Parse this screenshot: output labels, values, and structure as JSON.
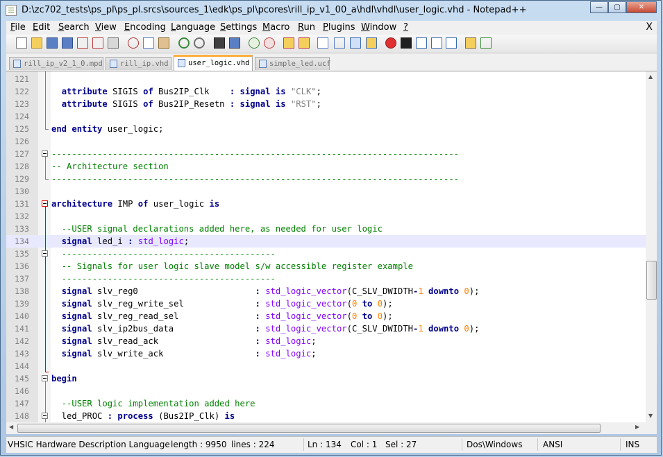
{
  "window": {
    "title": "D:\\zc702_tests\\ps_pl\\ps_pl.srcs\\sources_1\\edk\\ps_pl\\pcores\\rill_ip_v1_00_a\\hdl\\vhdl\\user_logic.vhd - Notepad++",
    "minimize": "—",
    "maximize": "▢",
    "close": "✕"
  },
  "menu": {
    "items": [
      {
        "label": "File"
      },
      {
        "label": "Edit"
      },
      {
        "label": "Search"
      },
      {
        "label": "View"
      },
      {
        "label": "Encoding"
      },
      {
        "label": "Language"
      },
      {
        "label": "Settings"
      },
      {
        "label": "Macro"
      },
      {
        "label": "Run"
      },
      {
        "label": "Plugins"
      },
      {
        "label": "Window"
      },
      {
        "label": "?"
      }
    ],
    "close": "X"
  },
  "toolbar": {
    "icons": [
      "new-file",
      "open-file",
      "save",
      "save-all",
      "close",
      "close-all",
      "print",
      "cut",
      "copy",
      "paste",
      "undo",
      "redo",
      "find",
      "replace",
      "zoom-in",
      "zoom-out",
      "sync-v",
      "sync-h",
      "word-wrap",
      "show-all-chars",
      "indent-guide",
      "user-lang",
      "record-macro",
      "stop-record",
      "play-macro",
      "run-macro-multiple",
      "save-macro",
      "doc-map",
      "spell-check"
    ]
  },
  "tabs": [
    {
      "label": "rill_ip_v2_1_0.mpd",
      "active": false
    },
    {
      "label": "rill_ip.vhd",
      "active": false
    },
    {
      "label": "user_logic.vhd",
      "active": true
    },
    {
      "label": "simple_led.ucf",
      "active": false
    }
  ],
  "editor": {
    "current_line": 134,
    "lines": [
      {
        "n": "121",
        "html": ""
      },
      {
        "n": "122",
        "html": "  <span class='kw'>attribute</span> SIGIS <span class='kw'>of</span> Bus2IP_Clk    <span class='op'>:</span> <span class='kw'>signal</span> <span class='kw'>is</span> <span class='st'>\"CLK\"</span>;"
      },
      {
        "n": "123",
        "html": "  <span class='kw'>attribute</span> SIGIS <span class='kw'>of</span> Bus2IP_Resetn <span class='op'>:</span> <span class='kw'>signal</span> <span class='kw'>is</span> <span class='st'>\"RST\"</span>;"
      },
      {
        "n": "124",
        "html": ""
      },
      {
        "n": "125",
        "html": "<span class='kw'>end</span> <span class='kw'>entity</span> user_logic;"
      },
      {
        "n": "126",
        "html": ""
      },
      {
        "n": "127",
        "html": "<span class='cm'>--------------------------------------------------------------------------------</span>"
      },
      {
        "n": "128",
        "html": "<span class='cm'>-- Architecture section</span>"
      },
      {
        "n": "129",
        "html": "<span class='cm'>--------------------------------------------------------------------------------</span>"
      },
      {
        "n": "130",
        "html": ""
      },
      {
        "n": "131",
        "html": "<span class='kw'>architecture</span> IMP <span class='kw'>of</span> user_logic <span class='kw'>is</span>"
      },
      {
        "n": "132",
        "html": ""
      },
      {
        "n": "133",
        "html": "  <span class='cm'>--USER signal declarations added here, as needed for user logic</span>"
      },
      {
        "n": "134",
        "html": "  <span class='kw'>signal</span> led_i <span class='op'>:</span> <span class='ty'>std_logic</span>;"
      },
      {
        "n": "135",
        "html": "  <span class='cm'>------------------------------------------</span>"
      },
      {
        "n": "136",
        "html": "  <span class='cm'>-- Signals for user logic slave model s/w accessible register example</span>"
      },
      {
        "n": "137",
        "html": "  <span class='cm'>------------------------------------------</span>"
      },
      {
        "n": "138",
        "html": "  <span class='kw'>signal</span> slv_reg0                       <span class='op'>:</span> <span class='ty'>std_logic_vector</span>(C_SLV_DWIDTH<span class='op'>-</span><span class='nm'>1</span> <span class='kw'>downto</span> <span class='nm'>0</span>);"
      },
      {
        "n": "139",
        "html": "  <span class='kw'>signal</span> slv_reg_write_sel              <span class='op'>:</span> <span class='ty'>std_logic_vector</span>(<span class='nm'>0</span> <span class='kw'>to</span> <span class='nm'>0</span>);"
      },
      {
        "n": "140",
        "html": "  <span class='kw'>signal</span> slv_reg_read_sel               <span class='op'>:</span> <span class='ty'>std_logic_vector</span>(<span class='nm'>0</span> <span class='kw'>to</span> <span class='nm'>0</span>);"
      },
      {
        "n": "141",
        "html": "  <span class='kw'>signal</span> slv_ip2bus_data                <span class='op'>:</span> <span class='ty'>std_logic_vector</span>(C_SLV_DWIDTH<span class='op'>-</span><span class='nm'>1</span> <span class='kw'>downto</span> <span class='nm'>0</span>);"
      },
      {
        "n": "142",
        "html": "  <span class='kw'>signal</span> slv_read_ack                   <span class='op'>:</span> <span class='ty'>std_logic</span>;"
      },
      {
        "n": "143",
        "html": "  <span class='kw'>signal</span> slv_write_ack                  <span class='op'>:</span> <span class='ty'>std_logic</span>;"
      },
      {
        "n": "144",
        "html": ""
      },
      {
        "n": "145",
        "html": "<span class='kw'>begin</span>"
      },
      {
        "n": "146",
        "html": ""
      },
      {
        "n": "147",
        "html": "  <span class='cm'>--USER logic implementation added here</span>"
      },
      {
        "n": "148",
        "html": "  led_PROC <span class='op'>:</span> <span class='kw'>process</span> (Bus2IP_Clk) <span class='kw'>is</span>"
      }
    ]
  },
  "status": {
    "language": "VHSIC Hardware Description Language",
    "length": "length : 9950",
    "lines": "lines : 224",
    "ln": "Ln : 134",
    "col": "Col : 1",
    "sel": "Sel : 27",
    "eol": "Dos\\Windows",
    "encoding": "ANSI",
    "mode": "INS"
  }
}
